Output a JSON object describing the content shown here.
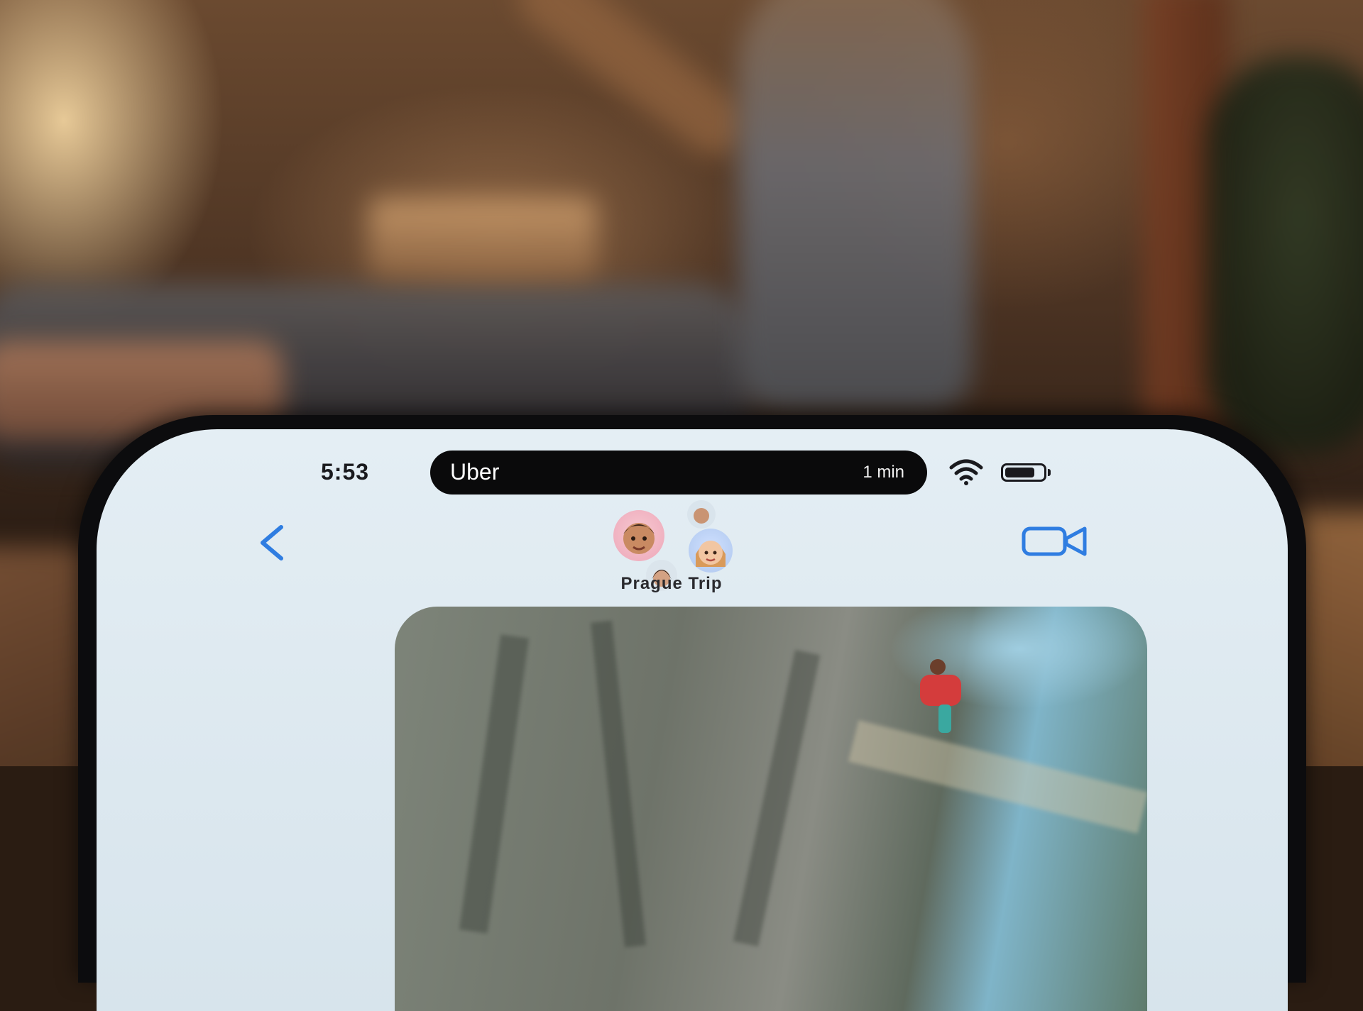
{
  "status_bar": {
    "time": "5:53",
    "live_activity": {
      "app_name": "Uber",
      "eta": "1 min"
    },
    "battery_level_fraction": 0.78,
    "icons": [
      "wifi-icon",
      "battery-icon"
    ]
  },
  "conversation_header": {
    "group_name": "Prague Trip",
    "back_icon": "chevron-left-icon",
    "video_icon": "video-camera-icon",
    "accent_color": "#2f7de1"
  },
  "avatars": [
    {
      "icon": "memoji-man-avatar"
    },
    {
      "icon": "memoji-small-avatar"
    },
    {
      "icon": "memoji-woman-avatar"
    },
    {
      "icon": "memoji-dark-hair-avatar"
    }
  ],
  "message": {
    "type": "photo",
    "description_icon": "photo-rock-climber"
  }
}
